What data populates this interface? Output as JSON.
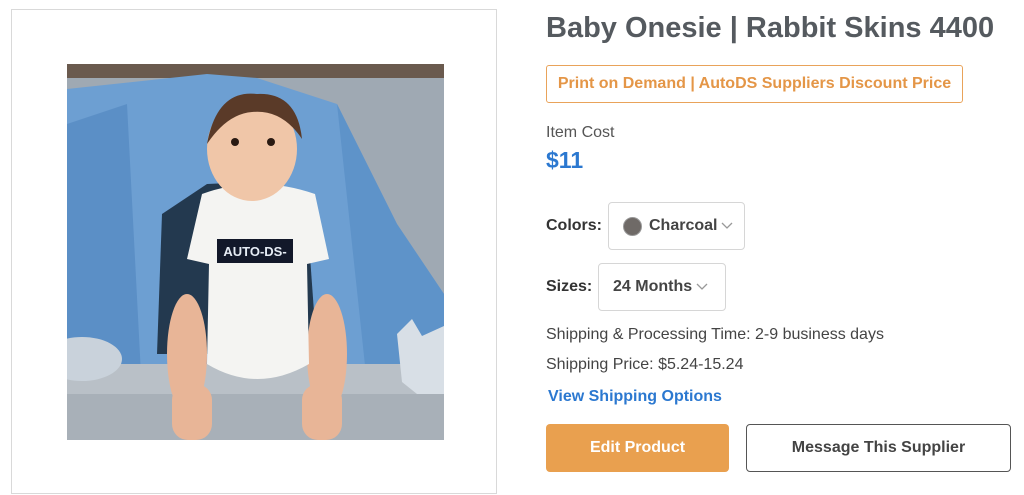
{
  "product": {
    "title": "Baby Onesie | Rabbit Skins 4400",
    "badge": "Print on Demand | AutoDS Suppliers Discount Price",
    "image": {
      "print_text": "AUTO-DS-"
    },
    "item_cost_label": "Item Cost",
    "item_cost_value": "$11",
    "colors": {
      "label": "Colors:",
      "selected": "Charcoal",
      "swatch_color": "#6f6a67"
    },
    "sizes": {
      "label": "Sizes:",
      "selected": "24 Months"
    },
    "shipping_time": "Shipping & Processing Time: 2-9 business days",
    "shipping_price": "Shipping Price: $5.24-15.24",
    "view_shipping_link": "View Shipping Options",
    "edit_button": "Edit Product",
    "message_button": "Message This Supplier"
  },
  "colors": {
    "accent_orange": "#e9a04f",
    "link_blue": "#2b78d0"
  }
}
